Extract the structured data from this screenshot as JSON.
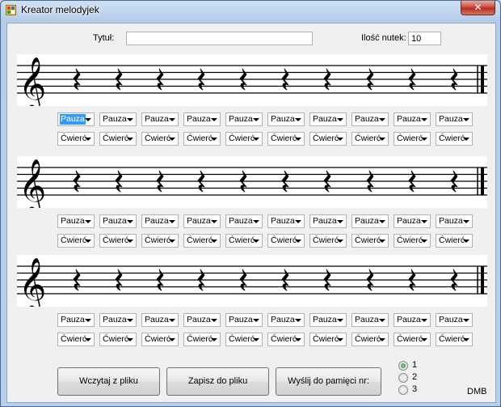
{
  "window": {
    "title": "Kreator melodyjek",
    "close_label": "✕"
  },
  "form": {
    "title_label": "Tytuł:",
    "title_value": "",
    "count_label": "Ilość nutek:",
    "count_value": "10"
  },
  "staves": [
    {
      "notes": [
        "Pauza",
        "Pauza",
        "Pauza",
        "Pauza",
        "Pauza",
        "Pauza",
        "Pauza",
        "Pauza",
        "Pauza",
        "Pauza"
      ],
      "durations": [
        "Ćwierć",
        "Ćwierć",
        "Ćwierć",
        "Ćwierć",
        "Ćwierć",
        "Ćwierć",
        "Ćwierć",
        "Ćwierć",
        "Ćwierć",
        "Ćwierć"
      ]
    },
    {
      "notes": [
        "Pauza",
        "Pauza",
        "Pauza",
        "Pauza",
        "Pauza",
        "Pauza",
        "Pauza",
        "Pauza",
        "Pauza",
        "Pauza"
      ],
      "durations": [
        "Ćwierć",
        "Ćwierć",
        "Ćwierć",
        "Ćwierć",
        "Ćwierć",
        "Ćwierć",
        "Ćwierć",
        "Ćwierć",
        "Ćwierć",
        "Ćwierć"
      ]
    },
    {
      "notes": [
        "Pauza",
        "Pauza",
        "Pauza",
        "Pauza",
        "Pauza",
        "Pauza",
        "Pauza",
        "Pauza",
        "Pauza",
        "Pauza"
      ],
      "durations": [
        "Ćwierć",
        "Ćwierć",
        "Ćwierć",
        "Ćwierć",
        "Ćwierć",
        "Ćwierć",
        "Ćwierć",
        "Ćwierć",
        "Ćwierć",
        "Ćwierć"
      ]
    }
  ],
  "buttons": {
    "load": "Wczytaj z pliku",
    "save": "Zapisz do pliku",
    "send": "Wyślij do pamięci nr:"
  },
  "memory_slots": {
    "options": [
      "1",
      "2",
      "3"
    ],
    "selected": "1"
  },
  "footer": {
    "credit": "DMB"
  }
}
